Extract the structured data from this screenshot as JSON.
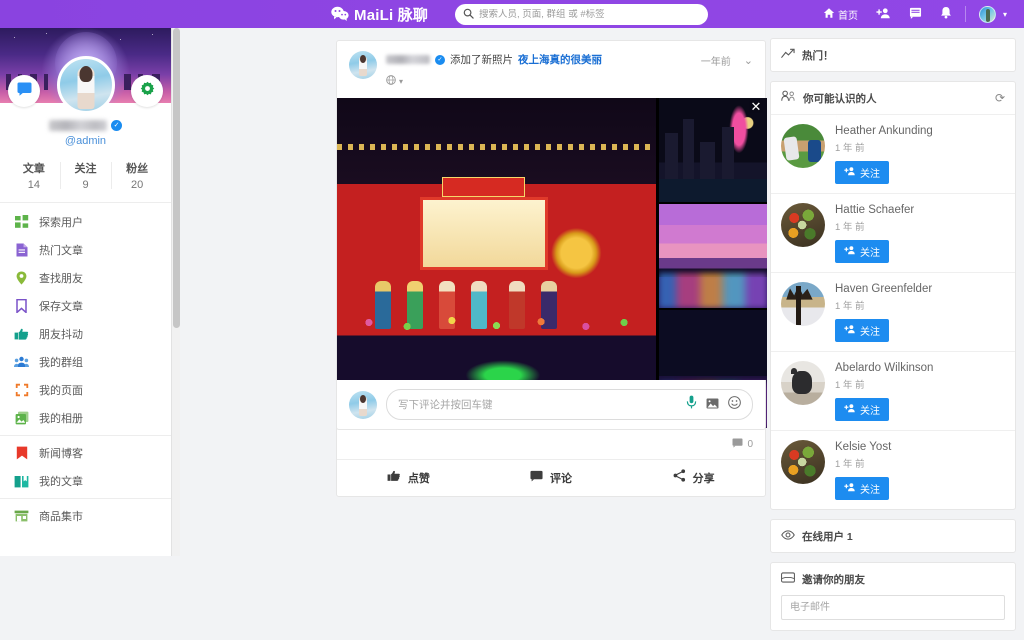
{
  "header": {
    "logo_icon": "wechat-bubbles-icon",
    "brand": "MaiLi 脉聊",
    "search": {
      "icon": "search-icon",
      "placeholder": "搜索人员, 页面, 群组 或 #标签",
      "value": ""
    },
    "nav": [
      {
        "icon": "home-icon",
        "label": "首页"
      },
      {
        "icon": "add-friend-icon",
        "label": ""
      },
      {
        "icon": "message-icon",
        "label": ""
      },
      {
        "icon": "bell-icon",
        "label": ""
      }
    ],
    "account": {
      "icon": "user-avatar",
      "caret": "chevron-down-icon"
    }
  },
  "sidebar": {
    "cover_icon": "night-sky-cover",
    "chat_button_icon": "chat-bubble-icon",
    "settings_button_icon": "gear-icon",
    "profile": {
      "name_masked": "",
      "verified_icon": "verified-badge-icon",
      "handle": "@admin"
    },
    "stats": [
      {
        "label": "文章",
        "value": "14"
      },
      {
        "label": "关注",
        "value": "9"
      },
      {
        "label": "粉丝",
        "value": "20"
      }
    ],
    "groups": [
      {
        "items": [
          {
            "label": "探索用户",
            "icon": "grid-icon",
            "color": "#5db34a"
          },
          {
            "label": "热门文章",
            "icon": "document-icon",
            "color": "#8a63d2"
          },
          {
            "label": "查找朋友",
            "icon": "map-pin-icon",
            "color": "#8aba3a"
          },
          {
            "label": "保存文章",
            "icon": "bookmark-icon",
            "color": "#7a52c8"
          },
          {
            "label": "朋友抖动",
            "icon": "hand-point-icon",
            "color": "#14a08c"
          },
          {
            "label": "我的群组",
            "icon": "people-group-icon",
            "color": "#2a7ad4"
          },
          {
            "label": "我的页面",
            "icon": "flag-icon",
            "color": "#ef7a2a"
          },
          {
            "label": "我的相册",
            "icon": "photo-stack-icon",
            "color": "#5db34a"
          }
        ]
      },
      {
        "items": [
          {
            "label": "新闻博客",
            "icon": "news-book-icon",
            "color": "#e8392a"
          },
          {
            "label": "我的文章",
            "icon": "open-book-icon",
            "color": "#14a08c"
          }
        ]
      },
      {
        "items": [
          {
            "label": "商品集市",
            "icon": "store-icon",
            "color": "#6aa84a"
          }
        ]
      }
    ]
  },
  "post": {
    "author_masked": "",
    "verified_icon": "verified-badge-icon",
    "action_text": "添加了新照片",
    "subject": "夜上海真的很美丽",
    "privacy_icon": "globe-icon",
    "privacy_caret": "caret-down-icon",
    "time": "一年前",
    "options_icon": "chevron-down-icon",
    "close_icon": "close-x-icon",
    "photos": [
      {
        "name": "lantern-festival-photo"
      },
      {
        "name": "shanghai-skyline-photo-1"
      },
      {
        "name": "shanghai-skyline-photo-2"
      },
      {
        "name": "shanghai-skyline-photo-3"
      }
    ],
    "comment_count": "0",
    "comment_count_icon": "comment-icon",
    "actions": [
      {
        "label": "点赞",
        "icon": "thumbs-up-icon"
      },
      {
        "label": "评论",
        "icon": "comment-icon"
      },
      {
        "label": "分享",
        "icon": "share-icon"
      }
    ],
    "comment_box": {
      "placeholder": "写下评论并按回车键",
      "value": "",
      "icons": [
        "microphone-icon",
        "image-icon",
        "emoji-icon"
      ]
    }
  },
  "rightbar": {
    "trending": {
      "icon": "trending-up-icon",
      "title": "热门！"
    },
    "suggestions": {
      "icon": "people-icon",
      "title": "你可能认识的人",
      "refresh_icon": "refresh-icon",
      "follow_icon": "add-person-icon",
      "people": [
        {
          "name": "Heather Ankunding",
          "time": "1 年 前",
          "follow_label": "关注",
          "avatar": "baseball-photo"
        },
        {
          "name": "Hattie Schaefer",
          "time": "1 年 前",
          "follow_label": "关注",
          "avatar": "food-photo"
        },
        {
          "name": "Haven Greenfelder",
          "time": "1 年 前",
          "follow_label": "关注",
          "avatar": "tree-painting-photo"
        },
        {
          "name": "Abelardo Wilkinson",
          "time": "1 年 前",
          "follow_label": "关注",
          "avatar": "cat-photo"
        },
        {
          "name": "Kelsie Yost",
          "time": "1 年 前",
          "follow_label": "关注",
          "avatar": "food-photo"
        }
      ]
    },
    "online": {
      "icon": "eye-icon",
      "title": "在线用户 1"
    },
    "invite": {
      "icon": "envelope-icon",
      "title": "邀请你的朋友",
      "placeholder": "电子邮件",
      "value": ""
    }
  },
  "colors": {
    "brand_purple": "#8e45e3",
    "link_blue": "#1a6fd4",
    "follow_blue": "#1d8cf0",
    "verified_blue": "#1a8cf0"
  }
}
